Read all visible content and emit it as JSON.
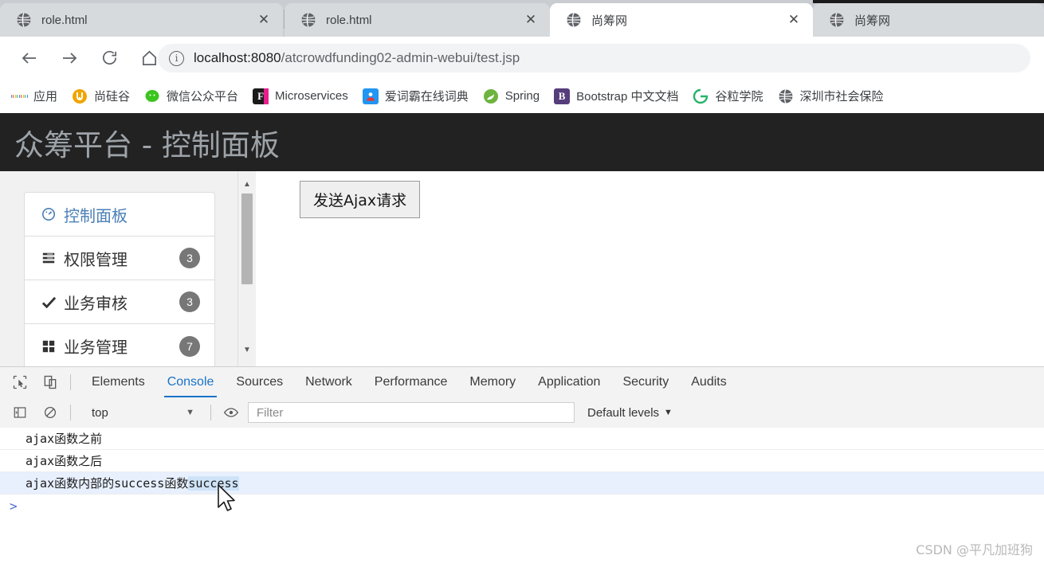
{
  "browser": {
    "tabs": [
      {
        "title": "role.html",
        "icon": "globe-icon",
        "active": false,
        "closable": true
      },
      {
        "title": "role.html",
        "icon": "globe-icon",
        "active": false,
        "closable": true
      },
      {
        "title": "尚筹网",
        "icon": "globe-icon",
        "active": true,
        "closable": true
      },
      {
        "title": "尚筹网",
        "icon": "globe-icon",
        "active": false,
        "closable": false
      }
    ],
    "nav": {
      "back_icon": "back-arrow-icon",
      "forward_icon": "forward-arrow-icon",
      "reload_icon": "reload-icon",
      "home_icon": "home-icon"
    },
    "omnibox": {
      "security_icon": "info-circle-icon",
      "url_host": "localhost:8080",
      "url_path": "/atcrowdfunding02-admin-webui/test.jsp"
    },
    "bookmarks": [
      {
        "label": "应用",
        "icon": "apps-grid-icon",
        "color": "#ffffff"
      },
      {
        "label": "尚硅谷",
        "icon": "atguigu-icon",
        "color": "#f0a500"
      },
      {
        "label": "微信公众平台",
        "icon": "wechat-icon",
        "color": "#3cc51f"
      },
      {
        "label": "Microservices",
        "icon": "feign-f-icon",
        "color": "#e91e8c"
      },
      {
        "label": "爱词霸在线词典",
        "icon": "iciba-icon",
        "color": "#2196f3"
      },
      {
        "label": "Spring",
        "icon": "spring-leaf-icon",
        "color": "#6db33f"
      },
      {
        "label": "Bootstrap 中文文档",
        "icon": "bootstrap-b-icon",
        "color": "#563d7c"
      },
      {
        "label": "谷粒学院",
        "icon": "guli-icon",
        "color": "#27b36a"
      },
      {
        "label": "深圳市社会保险",
        "icon": "globe-icon",
        "color": "#4a4a4a"
      }
    ]
  },
  "webpage": {
    "brand": "众筹平台 - 控制面板",
    "sidebar": [
      {
        "label": "控制面板",
        "icon": "dashboard-gauge-icon",
        "badge": "",
        "active": true
      },
      {
        "label": "权限管理",
        "icon": "list-lines-icon",
        "badge": "3",
        "active": false
      },
      {
        "label": "业务审核",
        "icon": "check-mark-icon",
        "badge": "3",
        "active": false
      },
      {
        "label": "业务管理",
        "icon": "grid-squares-icon",
        "badge": "7",
        "active": false
      }
    ],
    "content": {
      "ajax_button": "发送Ajax请求"
    },
    "scrollbar": {
      "up_icon": "triangle-up-icon",
      "down_icon": "triangle-down-icon"
    }
  },
  "devtools": {
    "inspect_icon": "inspect-cursor-icon",
    "device_icon": "device-toolbar-icon",
    "tabs": [
      {
        "label": "Elements",
        "active": false
      },
      {
        "label": "Console",
        "active": true
      },
      {
        "label": "Sources",
        "active": false
      },
      {
        "label": "Network",
        "active": false
      },
      {
        "label": "Performance",
        "active": false
      },
      {
        "label": "Memory",
        "active": false
      },
      {
        "label": "Application",
        "active": false
      },
      {
        "label": "Security",
        "active": false
      },
      {
        "label": "Audits",
        "active": false
      }
    ],
    "console_toolbar": {
      "sidebar_icon": "console-sidebar-icon",
      "clear_icon": "clear-console-icon",
      "context": "top",
      "context_caret": "▼",
      "eye_icon": "live-expression-icon",
      "filter_placeholder": "Filter",
      "levels_label": "Default levels",
      "levels_caret": "▼"
    },
    "logs": [
      {
        "text": "ajax函数之前",
        "highlight": false,
        "selected_suffix": ""
      },
      {
        "text": "ajax函数之后",
        "highlight": false,
        "selected_suffix": ""
      },
      {
        "text": "ajax函数内部的success函数",
        "highlight": true,
        "selected_suffix": "success"
      }
    ],
    "prompt": ">"
  },
  "watermark": "CSDN @平凡加班狗",
  "colors": {
    "accent": "#1a73c8",
    "tabstrip_bg": "#c9ccd1",
    "page_navbar_bg": "#222222",
    "badge_bg": "#777777",
    "selection": "#cfe3f7"
  }
}
